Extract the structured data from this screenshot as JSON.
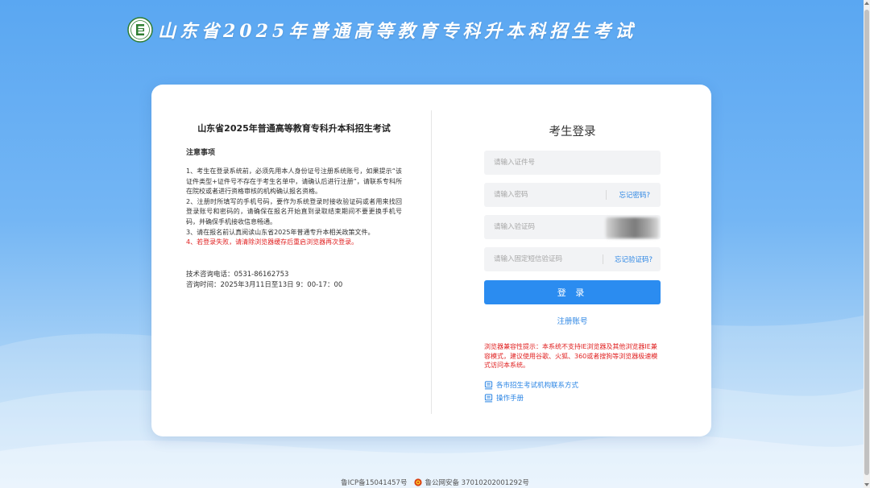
{
  "header": {
    "title": "山东省2025年普通高等教育专科升本科招生考试",
    "logo_icon": "exam-logo-icon"
  },
  "notice": {
    "title": "山东省2025年普通高等教育专科升本科招生考试",
    "subtitle": "注意事项",
    "item1": "1、考生在登录系统前，必须先用本人身份证号注册系统账号，如果提示“该证件类型+证件号不存在于考生名单中，请确认后进行注册”，请联系专科所在院校或者进行资格审核的机构确认报名资格。",
    "item2": "2、注册时所填写的手机号码，要作为系统登录时接收验证码或者用来找回登录账号和密码的，请确保在报名开始直到录取结束期间不要更换手机号码，并确保手机接收信息畅通。",
    "item3": "3、请在报名前认真阅读山东省2025年普通专升本相关政策文件。",
    "item4": "4、若登录失败，请清除浏览器缓存后重启浏览器再次登录。"
  },
  "contact": {
    "phone": "技术咨询电话：0531-86162753",
    "hours": "咨询时间：2025年3月11日至13日 9：00-17：00"
  },
  "login": {
    "title": "考生登录",
    "id_placeholder": "请输入证件号",
    "password_placeholder": "请输入密码",
    "forgot_password": "忘记密码?",
    "captcha_placeholder": "请输入验证码",
    "sms_placeholder": "请输入固定短信验证码",
    "forgot_sms": "忘记验证码?",
    "login_button": "登 录",
    "register": "注册账号",
    "compat_tip": "浏览器兼容性提示：本系统不支持IE浏览器及其他浏览器IE兼容模式，建议使用谷歌、火狐、360或者搜狗等浏览器极速模式访问本系统。",
    "link_contacts": "各市招生考试机构联系方式",
    "link_manual": "操作手册"
  },
  "footer": {
    "icp": "鲁ICP备15041457号",
    "police": "鲁公网安备 37010202001292号"
  },
  "colors": {
    "accent": "#2b8cf0",
    "link": "#2b85e4",
    "warning": "#e02020"
  }
}
